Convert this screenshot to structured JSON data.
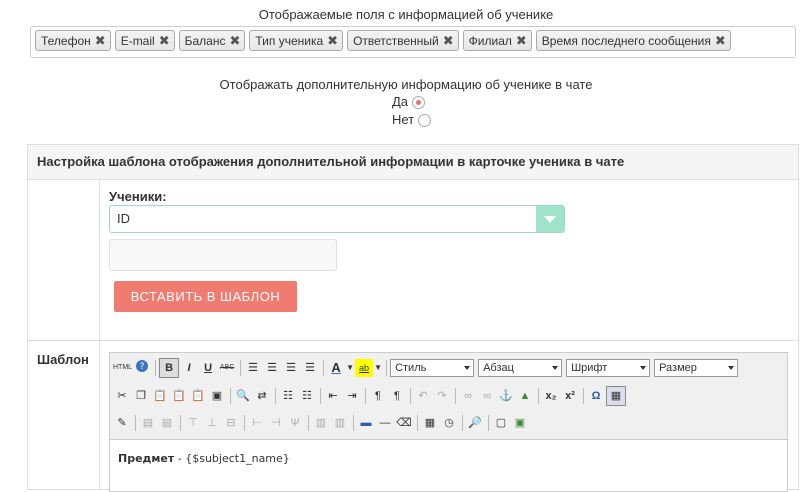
{
  "fields_title": "Отображаемые поля с информацией об ученике",
  "tags": [
    "Телефон",
    "E-mail",
    "Баланс",
    "Тип ученика",
    "Ответственный",
    "Филиал",
    "Время последнего сообщения"
  ],
  "show_title": "Отображать дополнительную информацию об ученике в чате",
  "option_yes": "Да",
  "option_no": "Нет",
  "selected_option": "yes",
  "panel_title": "Настройка шаблона отображения дополнительной информации в карточке ученика в чате",
  "students_label": "Ученики:",
  "students_select_value": "ID",
  "insert_button": "ВСТАВИТЬ В ШАБЛОН",
  "template_label": "Шаблон",
  "toolbar": {
    "style": "Стиль",
    "paragraph": "Абзац",
    "font": "Шрифт",
    "size": "Размер",
    "html": "HTML"
  },
  "editor_content_label": "Предмет",
  "editor_content_value": " - {$subject1_name}",
  "colors": {
    "accent": "#f07c71",
    "select_btn": "#9fe3cb"
  }
}
